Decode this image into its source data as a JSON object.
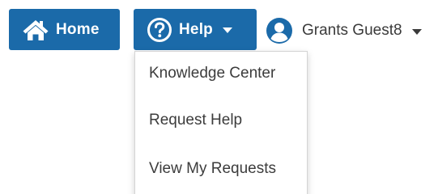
{
  "nav": {
    "home_label": "Home",
    "home_icon": "home-icon",
    "help_label": "Help",
    "help_icon": "question-circle-icon",
    "user_name": "Grants Guest8",
    "user_icon": "user-circle-icon"
  },
  "help_menu": {
    "items": [
      {
        "label": "Knowledge Center"
      },
      {
        "label": "Request Help"
      },
      {
        "label": "View My Requests"
      }
    ]
  },
  "colors": {
    "primary": "#1b6aa9",
    "text": "#3c3c3c",
    "background": "#ffffff"
  }
}
